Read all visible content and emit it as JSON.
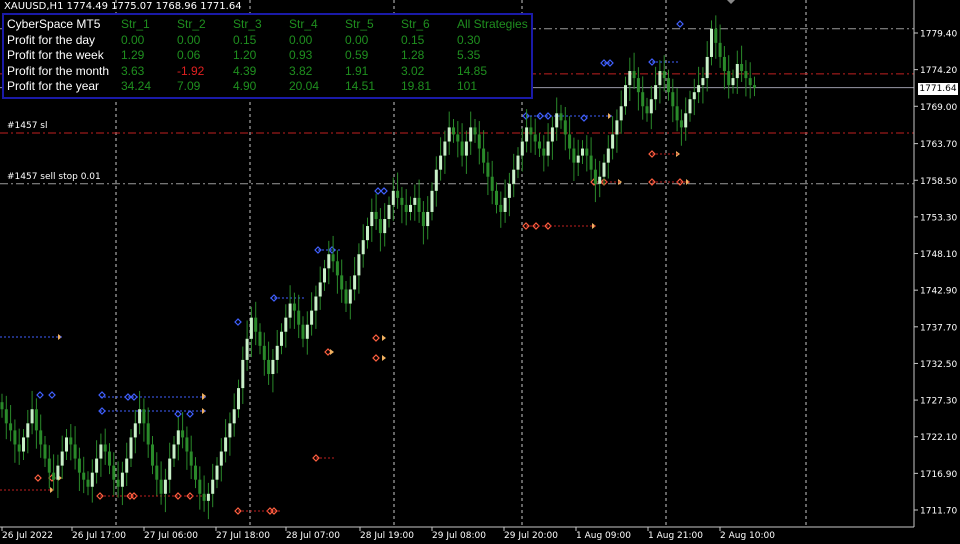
{
  "header": {
    "symbol_line": "XAUUSD,H1  1774.49 1775.07 1768.96 1771.64"
  },
  "panel": {
    "columns": [
      "CyberSpace MT5",
      "Str_1",
      "Str_2",
      "Str_3",
      "Str_4",
      "Str_5",
      "Str_6",
      "All Strategies"
    ],
    "rows": [
      {
        "label": "Profit for the day",
        "values": [
          "0.00",
          "0.00",
          "0.15",
          "0.00",
          "0.00",
          "0.15",
          "0.30"
        ]
      },
      {
        "label": "Profit for the week",
        "values": [
          "1.29",
          "0.06",
          "1.20",
          "0.93",
          "0.59",
          "1.28",
          "5.35"
        ]
      },
      {
        "label": "Profit for the month",
        "values": [
          "3.63",
          "-1.92",
          "4.39",
          "3.82",
          "1.91",
          "3.02",
          "14.85"
        ]
      },
      {
        "label": "Profit for the year",
        "values": [
          "34.24",
          "7.09",
          "4.90",
          "20.04",
          "14.51",
          "19.81",
          "101"
        ]
      }
    ]
  },
  "order_labels": {
    "sl": "#1457 sl",
    "sell_stop": "#1457 sell stop 0.01"
  },
  "current_price": "1771.64",
  "colors": {
    "bull": "#c8f0c8",
    "bear": "#2a8a2a",
    "grid": "#c8c8c8",
    "sl_line": "#c02020",
    "pos_pos": "#ff4040",
    "neg": "#e02020",
    "pos": "#1f8f1f",
    "header": "#2233dd"
  },
  "chart_data": {
    "type": "candlestick",
    "symbol": "XAUUSD",
    "timeframe": "H1",
    "y_ticks": [
      "1779.40",
      "1774.20",
      "1769.00",
      "1763.70",
      "1758.50",
      "1753.30",
      "1748.10",
      "1742.90",
      "1737.70",
      "1732.50",
      "1727.30",
      "1722.10",
      "1716.90",
      "1711.70"
    ],
    "x_ticks": [
      "26 Jul 2022",
      "26 Jul 17:00",
      "27 Jul 06:00",
      "27 Jul 18:00",
      "28 Jul 07:00",
      "28 Jul 19:00",
      "29 Jul 08:00",
      "29 Jul 20:00",
      "1 Aug 09:00",
      "1 Aug 21:00",
      "2 Aug 10:00"
    ],
    "ylim": [
      1710,
      1782
    ],
    "horizontal_levels": [
      {
        "price": 1765.2,
        "kind": "sl",
        "label": "#1457 sl"
      },
      {
        "price": 1758.0,
        "kind": "sell stop",
        "label": "#1457 sell stop 0.01"
      },
      {
        "price": 1773.6,
        "kind": "level"
      },
      {
        "price": 1780.0,
        "kind": "level"
      }
    ],
    "closes": [
      1726,
      1724,
      1723,
      1721,
      1720,
      1722,
      1724,
      1726,
      1723,
      1721,
      1719,
      1717,
      1716,
      1718,
      1720,
      1722,
      1721,
      1719,
      1717,
      1716,
      1715,
      1717,
      1719,
      1721,
      1720,
      1718,
      1716,
      1715,
      1717,
      1719,
      1722,
      1724,
      1726,
      1724,
      1721,
      1718,
      1716,
      1714,
      1716,
      1719,
      1721,
      1723,
      1722,
      1720,
      1718,
      1716,
      1714,
      1713,
      1714,
      1716,
      1718,
      1720,
      1722,
      1724,
      1726,
      1729,
      1733,
      1736,
      1739,
      1737,
      1735,
      1733,
      1731,
      1733,
      1735,
      1737,
      1739,
      1741,
      1740,
      1738,
      1736,
      1738,
      1740,
      1742,
      1744,
      1746,
      1748,
      1747,
      1745,
      1743,
      1741,
      1743,
      1745,
      1748,
      1750,
      1752,
      1754,
      1753,
      1751,
      1753,
      1755,
      1757,
      1756,
      1755,
      1754,
      1755,
      1756,
      1754,
      1752,
      1754,
      1757,
      1760,
      1762,
      1764,
      1766,
      1765,
      1764,
      1762,
      1764,
      1766,
      1765,
      1763,
      1761,
      1759,
      1757,
      1755,
      1754,
      1756,
      1758,
      1760,
      1762,
      1764,
      1766,
      1765,
      1764,
      1763,
      1762,
      1764,
      1766,
      1768,
      1767,
      1765,
      1763,
      1761,
      1762,
      1763,
      1762,
      1760,
      1758,
      1759,
      1761,
      1763,
      1765,
      1767,
      1769,
      1772,
      1774,
      1773,
      1771,
      1769,
      1768,
      1770,
      1772,
      1774,
      1773,
      1771,
      1769,
      1767,
      1766,
      1768,
      1770,
      1771,
      1772,
      1773,
      1776,
      1780,
      1778,
      1776,
      1774,
      1772,
      1773,
      1775,
      1774,
      1773,
      1772,
      1771.64
    ]
  }
}
